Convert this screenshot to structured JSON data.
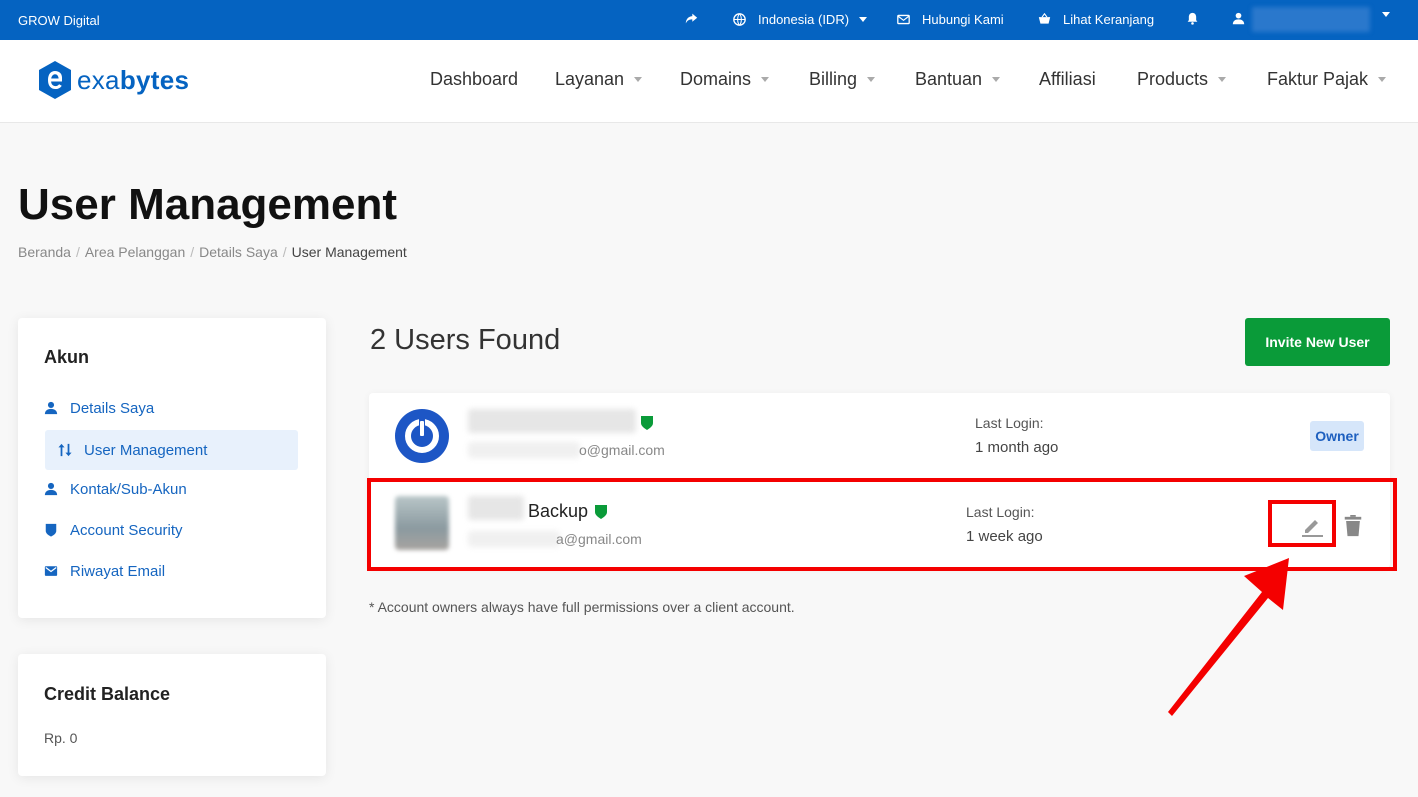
{
  "topbar": {
    "brand": "GROW Digital",
    "currency": "Indonesia (IDR)",
    "contact": "Hubungi Kami",
    "cart": "Lihat Keranjang"
  },
  "header": {
    "logo_prefix": "exa",
    "logo_suffix": "bytes",
    "nav": {
      "dashboard": "Dashboard",
      "layanan": "Layanan",
      "domains": "Domains",
      "billing": "Billing",
      "bantuan": "Bantuan",
      "affiliasi": "Affiliasi",
      "products": "Products",
      "faktur": "Faktur Pajak"
    }
  },
  "page": {
    "title": "User Management",
    "breadcrumb": [
      "Beranda",
      "Area Pelanggan",
      "Details Saya",
      "User Management"
    ]
  },
  "sidebar": {
    "akun_title": "Akun",
    "items": [
      {
        "label": "Details Saya",
        "icon": "user-icon"
      },
      {
        "label": "User Management",
        "icon": "swap-icon",
        "active": true
      },
      {
        "label": "Kontak/Sub-Akun",
        "icon": "user-icon"
      },
      {
        "label": "Account Security",
        "icon": "shield-icon"
      },
      {
        "label": "Riwayat Email",
        "icon": "envelope-icon"
      }
    ],
    "credit_title": "Credit Balance",
    "credit_value": "Rp. 0"
  },
  "main": {
    "users_found": "2 Users Found",
    "invite_button": "Invite New User",
    "users": [
      {
        "name": "",
        "email": "o@gmail.com",
        "last_login_label": "Last Login:",
        "last_login": "1 month ago",
        "badge": "Owner"
      },
      {
        "name": "Backup",
        "email": "a@gmail.com",
        "last_login_label": "Last Login:",
        "last_login": "1 week ago"
      }
    ],
    "note": "* Account owners always have full permissions over a client account."
  },
  "colors": {
    "topbar": "#0563c1",
    "primary": "#1565c0",
    "invite_green": "#0a9b39",
    "annotation_red": "#f40000"
  }
}
